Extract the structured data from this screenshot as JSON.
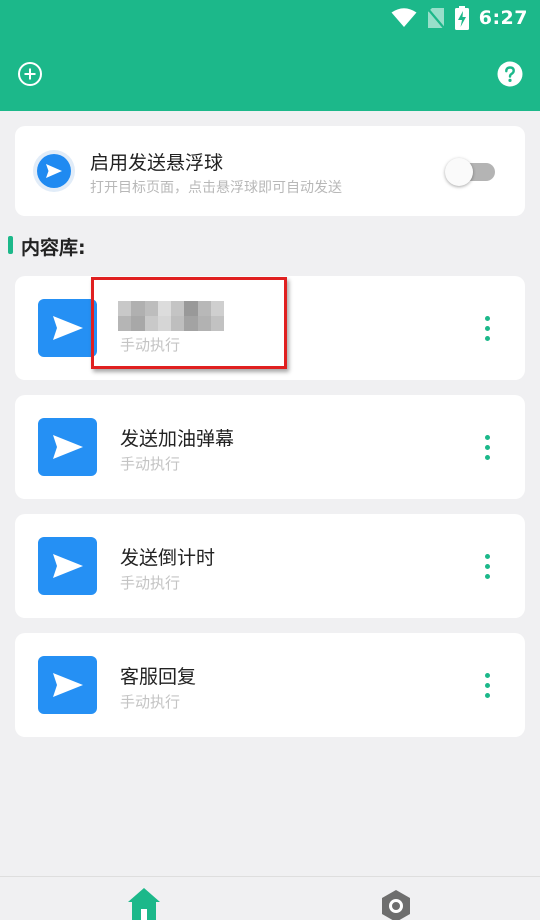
{
  "status_bar": {
    "time": "6:27",
    "icons": [
      "wifi-icon",
      "no-sim-icon",
      "battery-charging-icon"
    ]
  },
  "header": {
    "left_icon": "add-circle-icon",
    "right_icon": "help-icon"
  },
  "floating_ball": {
    "title": "启用发送悬浮球",
    "subtitle": "打开目标页面，点击悬浮球即可自动发送",
    "icon": "send-icon",
    "enabled": false
  },
  "library": {
    "title": "内容库:",
    "items": [
      {
        "title": "",
        "subtitle": "手动执行",
        "icon": "send-icon",
        "redacted": true
      },
      {
        "title": "发送加油弹幕",
        "subtitle": "手动执行",
        "icon": "send-icon"
      },
      {
        "title": "发送倒计时",
        "subtitle": "手动执行",
        "icon": "send-icon"
      },
      {
        "title": "客服回复",
        "subtitle": "手动执行",
        "icon": "send-icon"
      }
    ]
  },
  "bottom_nav": {
    "items": [
      {
        "icon": "home-icon",
        "active": true
      },
      {
        "icon": "settings-icon",
        "active": false
      }
    ]
  },
  "colors": {
    "primary": "#1cb88a",
    "accent_blue": "#2590f4",
    "background": "#f0f0f2",
    "highlight_red": "#e02020"
  }
}
